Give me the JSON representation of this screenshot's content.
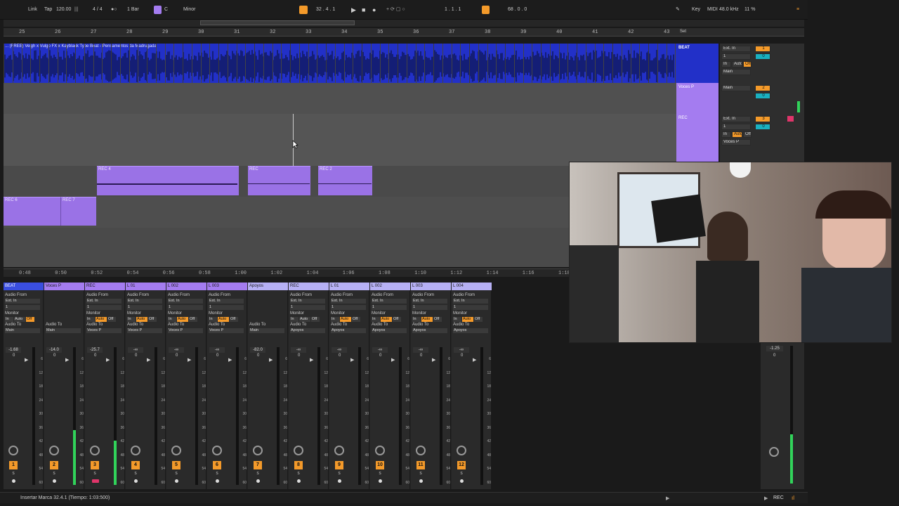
{
  "transport": {
    "link": "Link",
    "tap": "Tap",
    "tempo": "120.00",
    "sig": "4 / 4",
    "quant": "1 Bar",
    "key_root": "C",
    "scale": "Minor",
    "position": "32 .  4 .  1",
    "loop_start": "1 .  1 .  1",
    "cpu_field": "68 .  0 .  0",
    "key": "Key",
    "midi": "MIDI",
    "samplerate": "48.0 kHz",
    "cpu": "11 %"
  },
  "ruler": {
    "bars": [
      "25",
      "26",
      "27",
      "28",
      "29",
      "30",
      "31",
      "32",
      "33",
      "34",
      "35",
      "36",
      "37",
      "38",
      "39",
      "40",
      "41",
      "42",
      "43"
    ],
    "set_label": "Set"
  },
  "time_ruler": {
    "times": [
      "0:48",
      "0:50",
      "0:52",
      "0:54",
      "0:56",
      "0:58",
      "1:00",
      "1:02",
      "1:04",
      "1:06",
      "1:08",
      "1:10",
      "1:12",
      "1:14",
      "1:16",
      "1:18"
    ]
  },
  "arrangement": {
    "beat_clip_title": "... (FREE) Veigh x Vulgo FX x Kayblack Type Beat - Pensamentos da Madrugada",
    "clips": [
      {
        "label": "REC 4"
      },
      {
        "label": "REC"
      },
      {
        "label": "REC 2"
      },
      {
        "label": "REC 6"
      },
      {
        "label": "REC 7"
      }
    ]
  },
  "tracks": [
    {
      "name": "BEAT",
      "input": "Ext. In",
      "ch": "1",
      "monitor_in": "In",
      "monitor_auto": "Auto",
      "monitor_off": "Off",
      "output": "Main",
      "num": "1",
      "vol": "0"
    },
    {
      "name": "Voces P",
      "output": "Main",
      "num": "2",
      "vol": "0"
    },
    {
      "name": "REC",
      "input": "Ext. In",
      "ch": "1",
      "monitor_in": "In",
      "monitor_auto": "Auto",
      "monitor_off": "Off",
      "output": "Voces P",
      "num": "3",
      "vol": "0"
    }
  ],
  "mixer": {
    "labels": {
      "audio_from": "Audio From",
      "ext_in": "Ext. In",
      "ch": "1",
      "monitor": "Monitor",
      "in": "In",
      "auto": "Auto",
      "off": "Off",
      "audio_to": "Audio To"
    },
    "strips": [
      {
        "name": "BEAT",
        "color": "#3a4ee0",
        "to": "Main",
        "vol": "-1.68",
        "pan": "0",
        "num": "1",
        "meter": 0.0,
        "has_from": true,
        "sel": false
      },
      {
        "name": "Voces P",
        "color": "#a47cf0",
        "to": "Main",
        "vol": "-14.0",
        "pan": "0",
        "num": "2",
        "meter": 0.4,
        "has_from": false,
        "sel": false
      },
      {
        "name": "REC",
        "color": "#a47cf0",
        "to": "Voces P",
        "vol": "-25.7",
        "pan": "0",
        "num": "3",
        "meter": 0.32,
        "has_from": true,
        "sel": true
      },
      {
        "name": "L 01",
        "color": "#a47cf0",
        "to": "Voces P",
        "vol": "-∞",
        "pan": "0",
        "num": "4",
        "meter": 0.0,
        "has_from": true,
        "sel": false
      },
      {
        "name": "L 002",
        "color": "#a47cf0",
        "to": "Voces P",
        "vol": "-∞",
        "pan": "0",
        "num": "5",
        "meter": 0.0,
        "has_from": true,
        "sel": false
      },
      {
        "name": "L 003",
        "color": "#a47cf0",
        "to": "Voces P",
        "vol": "-∞",
        "pan": "0",
        "num": "6",
        "meter": 0.0,
        "has_from": true,
        "sel": false
      },
      {
        "name": "Apoyos",
        "color": "#b6b0f4",
        "to": "Main",
        "vol": "-82.0",
        "pan": "0",
        "num": "7",
        "meter": 0.0,
        "has_from": false,
        "sel": false
      },
      {
        "name": "REC",
        "color": "#b6b0f4",
        "to": "Apoyos",
        "vol": "-∞",
        "pan": "0",
        "num": "8",
        "meter": 0.0,
        "has_from": true,
        "sel": false
      },
      {
        "name": "L 01",
        "color": "#b6b0f4",
        "to": "Apoyos",
        "vol": "-∞",
        "pan": "0",
        "num": "9",
        "meter": 0.0,
        "has_from": true,
        "sel": false
      },
      {
        "name": "L 002",
        "color": "#b6b0f4",
        "to": "Apoyos",
        "vol": "-∞",
        "pan": "0",
        "num": "10",
        "meter": 0.0,
        "has_from": true,
        "sel": false
      },
      {
        "name": "L 003",
        "color": "#b6b0f4",
        "to": "Apoyos",
        "vol": "-∞",
        "pan": "0",
        "num": "11",
        "meter": 0.0,
        "has_from": true,
        "sel": false
      },
      {
        "name": "L 004",
        "color": "#b6b0f4",
        "to": "Apoyos",
        "vol": "-∞",
        "pan": "0",
        "num": "12",
        "meter": 0.0,
        "has_from": true,
        "sel": false
      }
    ],
    "scale_marks": [
      "6",
      "12",
      "18",
      "24",
      "30",
      "36",
      "42",
      "48",
      "54",
      "60"
    ],
    "master_vol": "-1.25",
    "master_pan": "0"
  },
  "status": {
    "message": "Insertar Marca 32.4.1 (Tiempo: 1:03:500)",
    "rec": "REC"
  },
  "colors": {
    "accent": "#f49a2a",
    "beat_blue": "#2230c8",
    "clip_purple": "#9a72e6",
    "meter_green": "#31d35a"
  }
}
